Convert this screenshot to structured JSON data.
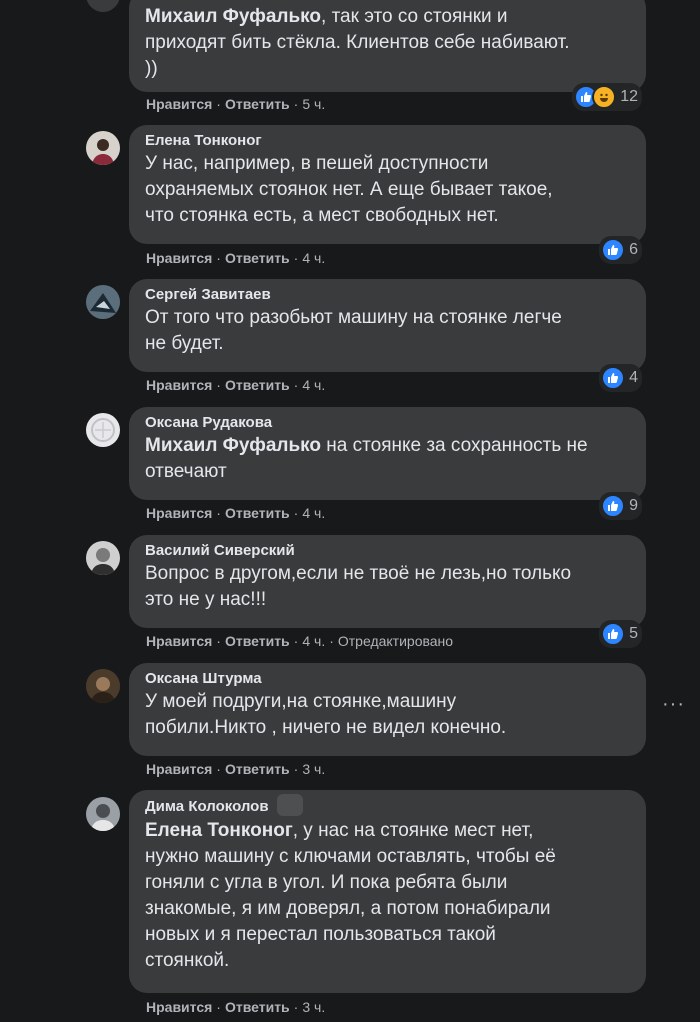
{
  "comments": [
    {
      "mention": "Михаил Фуфалько",
      "text": ", так это со стоянки и\nприходят бить стёкла. Клиентов себе набивают.\n))",
      "actions": {
        "like": "Нравится",
        "reply": "Ответить",
        "time": "5 ч."
      },
      "reactions": {
        "count": "12",
        "icons": [
          "like-icon",
          "haha-icon"
        ]
      }
    },
    {
      "name": "Елена Тонконог",
      "text": "У нас, например, в пешей доступности\nохраняемых стоянок нет. А еще бывает такое,\nчто стоянка есть, а мест свободных нет.",
      "actions": {
        "like": "Нравится",
        "reply": "Ответить",
        "time": "4 ч."
      },
      "reactions": {
        "count": "6",
        "icons": [
          "like-icon"
        ]
      }
    },
    {
      "name": "Сергей Завитаев",
      "text": "От того что разобьют машину на стоянке легче\nне будет.",
      "actions": {
        "like": "Нравится",
        "reply": "Ответить",
        "time": "4 ч."
      },
      "reactions": {
        "count": "4",
        "icons": [
          "like-icon"
        ]
      }
    },
    {
      "name": "Оксана Рудакова",
      "mention": "Михаил Фуфалько",
      "text": " на стоянке за сохранность не\nотвечают",
      "actions": {
        "like": "Нравится",
        "reply": "Ответить",
        "time": "4 ч."
      },
      "reactions": {
        "count": "9",
        "icons": [
          "like-icon"
        ]
      }
    },
    {
      "name": "Василий Сиверский",
      "text": "Вопрос в другом,если не твоё не лезь,но только\nэто не у нас!!!",
      "actions": {
        "like": "Нравится",
        "reply": "Ответить",
        "time": "4 ч.",
        "edited": "Отредактировано"
      },
      "reactions": {
        "count": "5",
        "icons": [
          "like-icon"
        ]
      }
    },
    {
      "name": "Оксана Штурма",
      "text": "У моей подруги,на стоянке,машину\nпобили.Никто , ничего не видел конечно.",
      "actions": {
        "like": "Нравится",
        "reply": "Ответить",
        "time": "3 ч."
      },
      "more": "···"
    },
    {
      "name": "Дима Колоколов",
      "mention": "Елена Тонконог",
      "text": ", у нас на стоянке мест нет,\nнужно машину с ключами оставлять, чтобы её\nгоняли с угла в угол. И пока ребята были\nзнакомые, я им доверял, а потом понабирали\nновых и я перестал пользоваться такой\nстоянкой.",
      "actions": {
        "like": "Нравится",
        "reply": "Ответить",
        "time": "3 ч."
      }
    }
  ]
}
